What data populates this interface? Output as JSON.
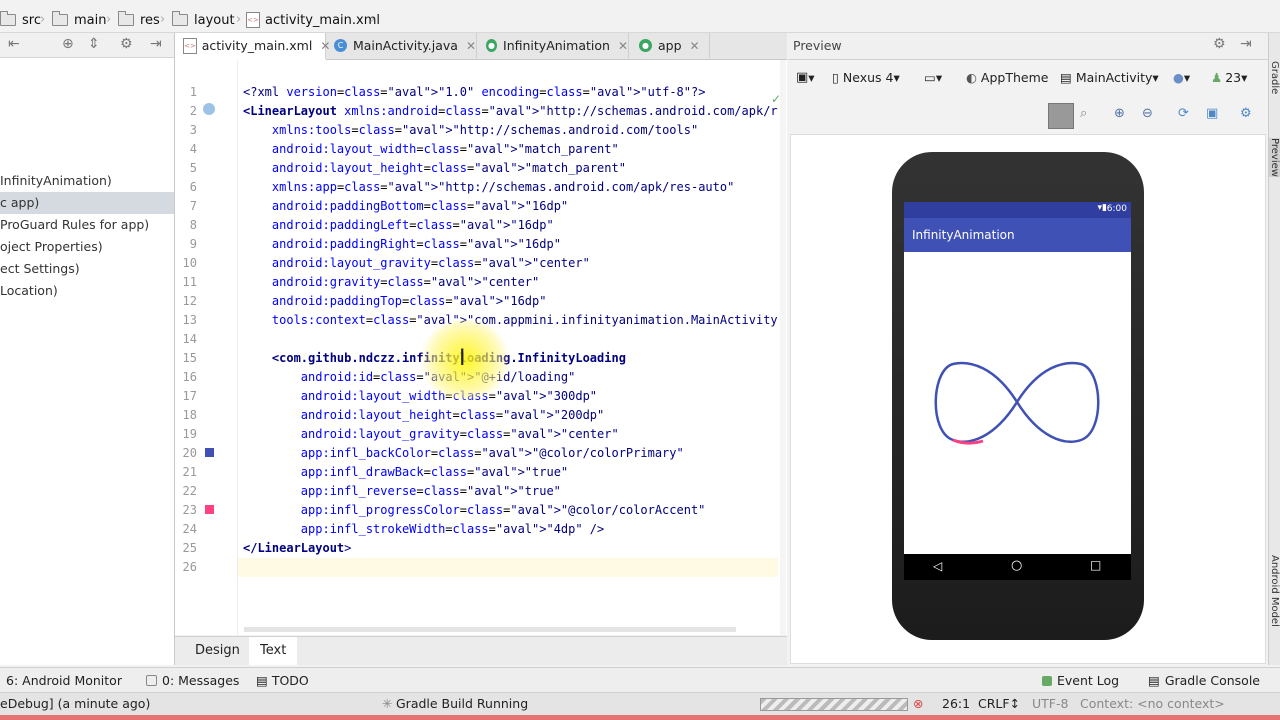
{
  "breadcrumb": [
    "src",
    "main",
    "res",
    "layout",
    "activity_main.xml"
  ],
  "project_tree": {
    "items": [
      "InfinityAnimation)",
      "c app)",
      "ProGuard Rules for app)",
      "oject Properties)",
      "ect Settings)",
      "Location)"
    ]
  },
  "tabs": [
    {
      "label": "activity_main.xml",
      "active": true
    },
    {
      "label": "MainActivity.java",
      "active": false
    },
    {
      "label": "InfinityAnimation",
      "active": false
    },
    {
      "label": "app",
      "active": false
    }
  ],
  "editor": {
    "line_numbers": [
      "1",
      "2",
      "3",
      "4",
      "5",
      "6",
      "7",
      "8",
      "9",
      "10",
      "11",
      "12",
      "13",
      "14",
      "15",
      "16",
      "17",
      "18",
      "19",
      "20",
      "21",
      "22",
      "23",
      "24",
      "25",
      "26"
    ],
    "lines": [
      "<?xml version=\"1.0\" encoding=\"utf-8\"?>",
      "<LinearLayout xmlns:android=\"http://schemas.android.com/apk/res/android\"",
      "    xmlns:tools=\"http://schemas.android.com/tools\"",
      "    android:layout_width=\"match_parent\"",
      "    android:layout_height=\"match_parent\"",
      "    xmlns:app=\"http://schemas.android.com/apk/res-auto\"",
      "    android:paddingBottom=\"16dp\"",
      "    android:paddingLeft=\"16dp\"",
      "    android:paddingRight=\"16dp\"",
      "    android:layout_gravity=\"center\"",
      "    android:gravity=\"center\"",
      "    android:paddingTop=\"16dp\"",
      "    tools:context=\"com.appmini.infinityanimation.MainActivity\">",
      "",
      "    <com.github.ndczz.infinityloading.InfinityLoading",
      "        android:id=\"@+id/loading\"",
      "        android:layout_width=\"300dp\"",
      "        android:layout_height=\"200dp\"",
      "        android:layout_gravity=\"center\"",
      "        app:infl_backColor=\"@color/colorPrimary\"",
      "        app:infl_drawBack=\"true\"",
      "        app:infl_reverse=\"true\"",
      "        app:infl_progressColor=\"@color/colorAccent\"",
      "        app:infl_strokeWidth=\"4dp\" />",
      "</LinearLayout>",
      ""
    ]
  },
  "editor_mode_tabs": {
    "design": "Design",
    "text": "Text"
  },
  "preview": {
    "title": "Preview",
    "device": "Nexus 4",
    "theme": "AppTheme",
    "activity": "MainActivity",
    "api": "23",
    "phone_time": "6:00",
    "app_title": "InfinityAnimation"
  },
  "right_strip": {
    "top": "Gradle",
    "mid": "Preview",
    "bottom": "Android Model"
  },
  "tool_windows": {
    "android_monitor": "6: Android Monitor",
    "messages": "0: Messages",
    "todo": "TODO",
    "event_log": "Event Log",
    "gradle_console": "Gradle Console"
  },
  "status": {
    "left": "eDebug] (a minute ago)",
    "build": "Gradle Build Running",
    "position": "26:1",
    "line_sep": "CRLF↕",
    "encoding": "UTF-8",
    "context": "Context: <no context>"
  },
  "colors": {
    "primary": "#3f51b5",
    "accent": "#ff4081",
    "primary_dark": "#303f9f"
  }
}
